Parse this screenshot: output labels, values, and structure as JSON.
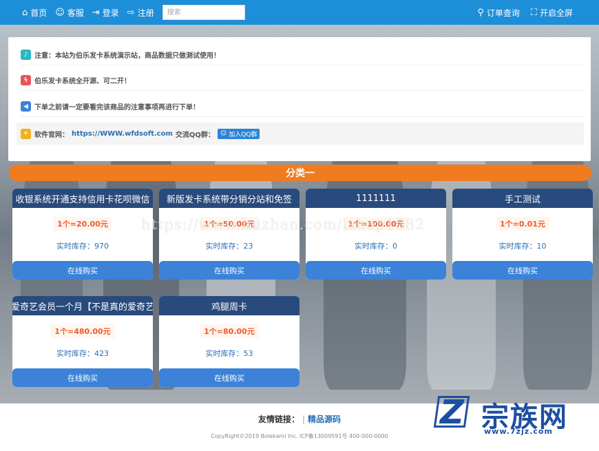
{
  "nav": {
    "home": "首页",
    "service": "客服",
    "login": "登录",
    "register": "注册",
    "search_placeholder": "搜索",
    "order_query": "订单查询",
    "fullscreen": "开启全屏"
  },
  "notices": [
    {
      "text": "注意：本站为伯乐发卡系统演示站，商品数据只做测试使用！",
      "color": "#2bb6c4"
    },
    {
      "text": "伯乐发卡系统全开源、可二开！",
      "color": "#e9545a"
    },
    {
      "text": "下单之前请一定要看完该商品的注意事项再进行下单！",
      "color": "#3b82d8"
    }
  ],
  "official": {
    "label": "软件官网：",
    "url": "https://WWW.wfdsoft.com",
    "qq_label": "交流QQ群：",
    "qq_button": "加入QQ群",
    "color": "#f2b01e"
  },
  "category": "分类一",
  "products": [
    {
      "name": "收银系统开通支持信用卡花呗微信",
      "price": "1个=20.00元",
      "stock_label": "实时库存：",
      "stock": "970",
      "buy": "在线购买"
    },
    {
      "name": "新版发卡系统带分销分站和免签",
      "price": "1个=50.00元",
      "stock_label": "实时库存：",
      "stock": "23",
      "buy": "在线购买"
    },
    {
      "name": "1111111",
      "price": "1个=100.00元",
      "stock_label": "实时库存：",
      "stock": "0",
      "buy": "在线购买"
    },
    {
      "name": "手工测试",
      "price": "1个=0.01元",
      "stock_label": "实时库存：",
      "stock": "10",
      "buy": "在线购买"
    },
    {
      "name": "爱奇艺会员一个月【不是真的爱奇艺",
      "price": "1个=480.00元",
      "stock_label": "实时库存：",
      "stock": "423",
      "buy": "在线购买"
    },
    {
      "name": "鸡腿周卡",
      "price": "1个=80.00元",
      "stock_label": "实时库存：",
      "stock": "53",
      "buy": "在线购买"
    }
  ],
  "watermark": "https://www.huzhan.com/ishop1582",
  "footer": {
    "links_label": "友情链接：",
    "sep": "|",
    "link1": "精品源码",
    "copyright": "CopyRight©2019 Bolekami Inc.   ICP备13009591号   400-000-0000"
  },
  "logo": {
    "letter": "Z",
    "name": "宗族网",
    "url": "www.7zjz.com"
  }
}
